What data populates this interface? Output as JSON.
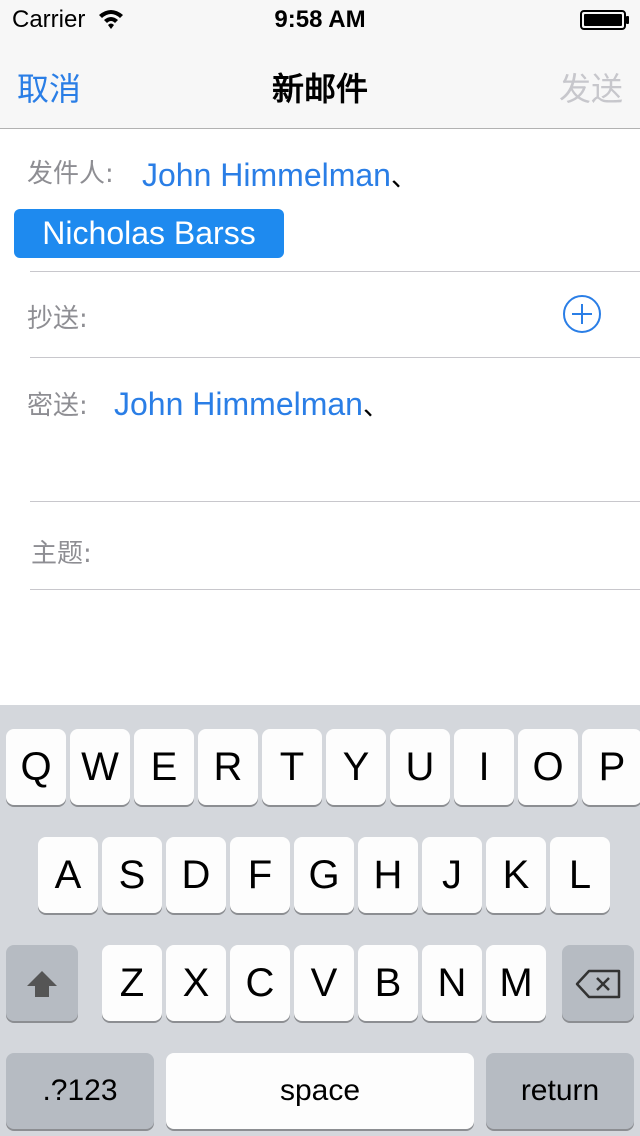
{
  "status_bar": {
    "carrier": "Carrier",
    "time": "9:58 AM"
  },
  "nav": {
    "cancel": "取消",
    "title": "新邮件",
    "send": "发送"
  },
  "compose": {
    "from_label": "发件人:",
    "from_recipients": [
      "John Himmelman",
      "Nicholas Barss"
    ],
    "separator": "、",
    "cc_label": "抄送:",
    "bcc_label": "密送:",
    "bcc_recipients": [
      "John Himmelman"
    ],
    "subject_label": "主题:"
  },
  "keyboard": {
    "row1": [
      "Q",
      "W",
      "E",
      "R",
      "T",
      "Y",
      "U",
      "I",
      "O",
      "P"
    ],
    "row2": [
      "A",
      "S",
      "D",
      "F",
      "G",
      "H",
      "J",
      "K",
      "L"
    ],
    "row3": [
      "Z",
      "X",
      "C",
      "V",
      "B",
      "N",
      "M"
    ],
    "numbers": ".?123",
    "space": "space",
    "return": "return"
  },
  "colors": {
    "accent": "#2a7ee6",
    "chip": "#1e8aef",
    "disabled": "#c7c7cc",
    "label": "#8e8e93"
  },
  "icons": [
    "wifi-icon",
    "battery-icon",
    "add-cc-icon",
    "shift-icon",
    "backspace-icon"
  ]
}
